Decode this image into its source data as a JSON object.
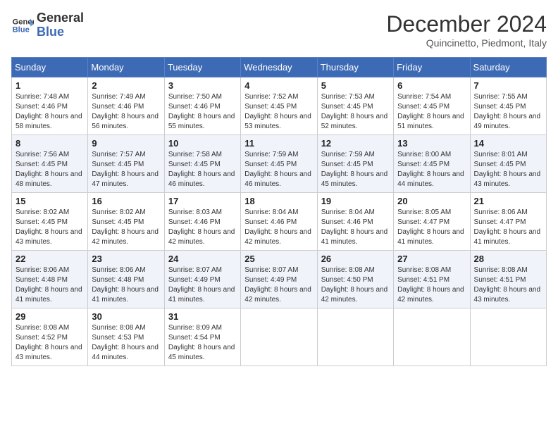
{
  "header": {
    "logo_line1": "General",
    "logo_line2": "Blue",
    "month_title": "December 2024",
    "location": "Quincinetto, Piedmont, Italy"
  },
  "weekdays": [
    "Sunday",
    "Monday",
    "Tuesday",
    "Wednesday",
    "Thursday",
    "Friday",
    "Saturday"
  ],
  "weeks": [
    [
      {
        "day": 1,
        "sunrise": "7:48 AM",
        "sunset": "4:46 PM",
        "daylight": "8 hours and 58 minutes."
      },
      {
        "day": 2,
        "sunrise": "7:49 AM",
        "sunset": "4:46 PM",
        "daylight": "8 hours and 56 minutes."
      },
      {
        "day": 3,
        "sunrise": "7:50 AM",
        "sunset": "4:46 PM",
        "daylight": "8 hours and 55 minutes."
      },
      {
        "day": 4,
        "sunrise": "7:52 AM",
        "sunset": "4:45 PM",
        "daylight": "8 hours and 53 minutes."
      },
      {
        "day": 5,
        "sunrise": "7:53 AM",
        "sunset": "4:45 PM",
        "daylight": "8 hours and 52 minutes."
      },
      {
        "day": 6,
        "sunrise": "7:54 AM",
        "sunset": "4:45 PM",
        "daylight": "8 hours and 51 minutes."
      },
      {
        "day": 7,
        "sunrise": "7:55 AM",
        "sunset": "4:45 PM",
        "daylight": "8 hours and 49 minutes."
      }
    ],
    [
      {
        "day": 8,
        "sunrise": "7:56 AM",
        "sunset": "4:45 PM",
        "daylight": "8 hours and 48 minutes."
      },
      {
        "day": 9,
        "sunrise": "7:57 AM",
        "sunset": "4:45 PM",
        "daylight": "8 hours and 47 minutes."
      },
      {
        "day": 10,
        "sunrise": "7:58 AM",
        "sunset": "4:45 PM",
        "daylight": "8 hours and 46 minutes."
      },
      {
        "day": 11,
        "sunrise": "7:59 AM",
        "sunset": "4:45 PM",
        "daylight": "8 hours and 46 minutes."
      },
      {
        "day": 12,
        "sunrise": "7:59 AM",
        "sunset": "4:45 PM",
        "daylight": "8 hours and 45 minutes."
      },
      {
        "day": 13,
        "sunrise": "8:00 AM",
        "sunset": "4:45 PM",
        "daylight": "8 hours and 44 minutes."
      },
      {
        "day": 14,
        "sunrise": "8:01 AM",
        "sunset": "4:45 PM",
        "daylight": "8 hours and 43 minutes."
      }
    ],
    [
      {
        "day": 15,
        "sunrise": "8:02 AM",
        "sunset": "4:45 PM",
        "daylight": "8 hours and 43 minutes."
      },
      {
        "day": 16,
        "sunrise": "8:02 AM",
        "sunset": "4:45 PM",
        "daylight": "8 hours and 42 minutes."
      },
      {
        "day": 17,
        "sunrise": "8:03 AM",
        "sunset": "4:46 PM",
        "daylight": "8 hours and 42 minutes."
      },
      {
        "day": 18,
        "sunrise": "8:04 AM",
        "sunset": "4:46 PM",
        "daylight": "8 hours and 42 minutes."
      },
      {
        "day": 19,
        "sunrise": "8:04 AM",
        "sunset": "4:46 PM",
        "daylight": "8 hours and 41 minutes."
      },
      {
        "day": 20,
        "sunrise": "8:05 AM",
        "sunset": "4:47 PM",
        "daylight": "8 hours and 41 minutes."
      },
      {
        "day": 21,
        "sunrise": "8:06 AM",
        "sunset": "4:47 PM",
        "daylight": "8 hours and 41 minutes."
      }
    ],
    [
      {
        "day": 22,
        "sunrise": "8:06 AM",
        "sunset": "4:48 PM",
        "daylight": "8 hours and 41 minutes."
      },
      {
        "day": 23,
        "sunrise": "8:06 AM",
        "sunset": "4:48 PM",
        "daylight": "8 hours and 41 minutes."
      },
      {
        "day": 24,
        "sunrise": "8:07 AM",
        "sunset": "4:49 PM",
        "daylight": "8 hours and 41 minutes."
      },
      {
        "day": 25,
        "sunrise": "8:07 AM",
        "sunset": "4:49 PM",
        "daylight": "8 hours and 42 minutes."
      },
      {
        "day": 26,
        "sunrise": "8:08 AM",
        "sunset": "4:50 PM",
        "daylight": "8 hours and 42 minutes."
      },
      {
        "day": 27,
        "sunrise": "8:08 AM",
        "sunset": "4:51 PM",
        "daylight": "8 hours and 42 minutes."
      },
      {
        "day": 28,
        "sunrise": "8:08 AM",
        "sunset": "4:51 PM",
        "daylight": "8 hours and 43 minutes."
      }
    ],
    [
      {
        "day": 29,
        "sunrise": "8:08 AM",
        "sunset": "4:52 PM",
        "daylight": "8 hours and 43 minutes."
      },
      {
        "day": 30,
        "sunrise": "8:08 AM",
        "sunset": "4:53 PM",
        "daylight": "8 hours and 44 minutes."
      },
      {
        "day": 31,
        "sunrise": "8:09 AM",
        "sunset": "4:54 PM",
        "daylight": "8 hours and 45 minutes."
      },
      null,
      null,
      null,
      null
    ]
  ]
}
